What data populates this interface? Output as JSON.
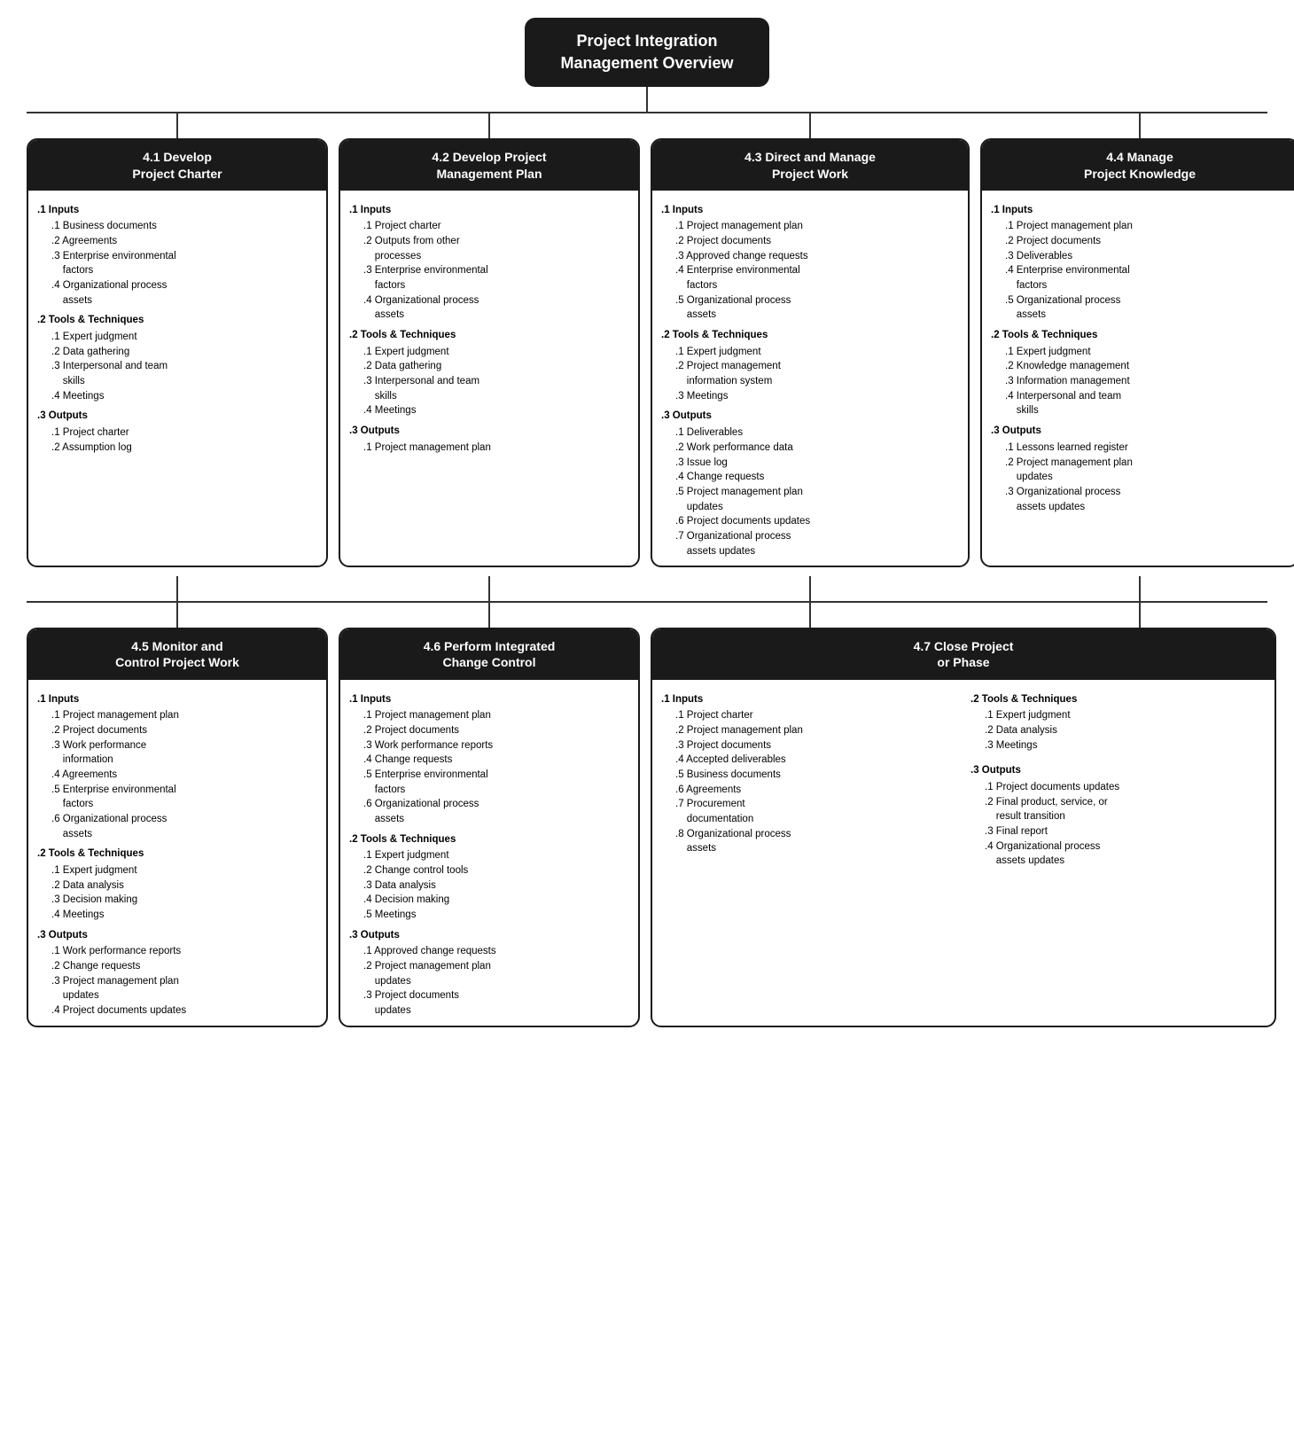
{
  "title": {
    "line1": "Project Integration",
    "line2": "Management Overview"
  },
  "processes": {
    "p41": {
      "header": "4.1 Develop\nProject Charter",
      "inputs_title": ".1 Inputs",
      "inputs": [
        ".1 Business documents",
        ".2 Agreements",
        ".3 Enterprise environmental\n    factors",
        ".4 Organizational process\n    assets"
      ],
      "tools_title": ".2 Tools & Techniques",
      "tools": [
        ".1 Expert judgment",
        ".2 Data gathering",
        ".3 Interpersonal and team\n    skills",
        ".4 Meetings"
      ],
      "outputs_title": ".3 Outputs",
      "outputs": [
        ".1 Project charter",
        ".2 Assumption log"
      ]
    },
    "p42": {
      "header": "4.2 Develop Project\nManagement Plan",
      "inputs_title": ".1 Inputs",
      "inputs": [
        ".1 Project charter",
        ".2 Outputs from other\n    processes",
        ".3 Enterprise environmental\n    factors",
        ".4 Organizational process\n    assets"
      ],
      "tools_title": ".2 Tools & Techniques",
      "tools": [
        ".1 Expert judgment",
        ".2 Data gathering",
        ".3 Interpersonal and team\n    skills",
        ".4 Meetings"
      ],
      "outputs_title": ".3 Outputs",
      "outputs": [
        ".1 Project management plan"
      ]
    },
    "p43": {
      "header": "4.3 Direct and Manage\nProject Work",
      "inputs_title": ".1 Inputs",
      "inputs": [
        ".1 Project management plan",
        ".2 Project documents",
        ".3 Approved change requests",
        ".4 Enterprise environmental\n    factors",
        ".5 Organizational process\n    assets"
      ],
      "tools_title": ".2 Tools & Techniques",
      "tools": [
        ".1 Expert judgment",
        ".2 Project management\n    information system",
        ".3 Meetings"
      ],
      "outputs_title": ".3 Outputs",
      "outputs": [
        ".1 Deliverables",
        ".2 Work performance data",
        ".3 Issue log",
        ".4 Change requests",
        ".5 Project management plan\n    updates",
        ".6 Project documents updates",
        ".7 Organizational process\n    assets updates"
      ]
    },
    "p44": {
      "header": "4.4 Manage\nProject Knowledge",
      "inputs_title": ".1 Inputs",
      "inputs": [
        ".1 Project management plan",
        ".2 Project documents",
        ".3 Deliverables",
        ".4 Enterprise environmental\n    factors",
        ".5 Organizational process\n    assets"
      ],
      "tools_title": ".2 Tools & Techniques",
      "tools": [
        ".1 Expert judgment",
        ".2 Knowledge management",
        ".3 Information management",
        ".4 Interpersonal and team\n    skills"
      ],
      "outputs_title": ".3 Outputs",
      "outputs": [
        ".1 Lessons learned register",
        ".2 Project management plan\n    updates",
        ".3 Organizational process\n    assets updates"
      ]
    },
    "p45": {
      "header": "4.5 Monitor and\nControl Project Work",
      "inputs_title": ".1 Inputs",
      "inputs": [
        ".1 Project management plan",
        ".2 Project documents",
        ".3 Work performance\n    information",
        ".4 Agreements",
        ".5 Enterprise environmental\n    factors",
        ".6 Organizational process\n    assets"
      ],
      "tools_title": ".2 Tools & Techniques",
      "tools": [
        ".1 Expert judgment",
        ".2 Data analysis",
        ".3 Decision making",
        ".4 Meetings"
      ],
      "outputs_title": ".3 Outputs",
      "outputs": [
        ".1 Work performance reports",
        ".2 Change requests",
        ".3 Project management plan\n    updates",
        ".4 Project documents updates"
      ]
    },
    "p46": {
      "header": "4.6 Perform Integrated\nChange Control",
      "inputs_title": ".1 Inputs",
      "inputs": [
        ".1 Project management plan",
        ".2 Project documents",
        ".3 Work performance reports",
        ".4 Change requests",
        ".5 Enterprise environmental\n    factors",
        ".6 Organizational process\n    assets"
      ],
      "tools_title": ".2 Tools & Techniques",
      "tools": [
        ".1 Expert judgment",
        ".2 Change control tools",
        ".3 Data analysis",
        ".4 Decision making",
        ".5 Meetings"
      ],
      "outputs_title": ".3 Outputs",
      "outputs": [
        ".1 Approved change requests",
        ".2 Project management plan\n    updates",
        ".3 Project documents\n    updates"
      ]
    },
    "p47": {
      "header": "4.7 Close Project\nor Phase",
      "inputs_title": ".1 Inputs",
      "inputs": [
        ".1 Project charter",
        ".2 Project management plan",
        ".3 Project documents",
        ".4 Accepted deliverables",
        ".5 Business documents",
        ".6 Agreements",
        ".7 Procurement\n    documentation",
        ".8 Organizational process\n    assets"
      ],
      "tools_title": ".2 Tools & Techniques",
      "tools": [
        ".1 Expert judgment",
        ".2 Data analysis",
        ".3 Meetings"
      ],
      "outputs_title": ".3 Outputs",
      "outputs": [
        ".1 Project documents updates",
        ".2 Final product, service, or\n    result transition",
        ".3 Final report",
        ".4 Organizational process\n    assets updates"
      ]
    }
  }
}
